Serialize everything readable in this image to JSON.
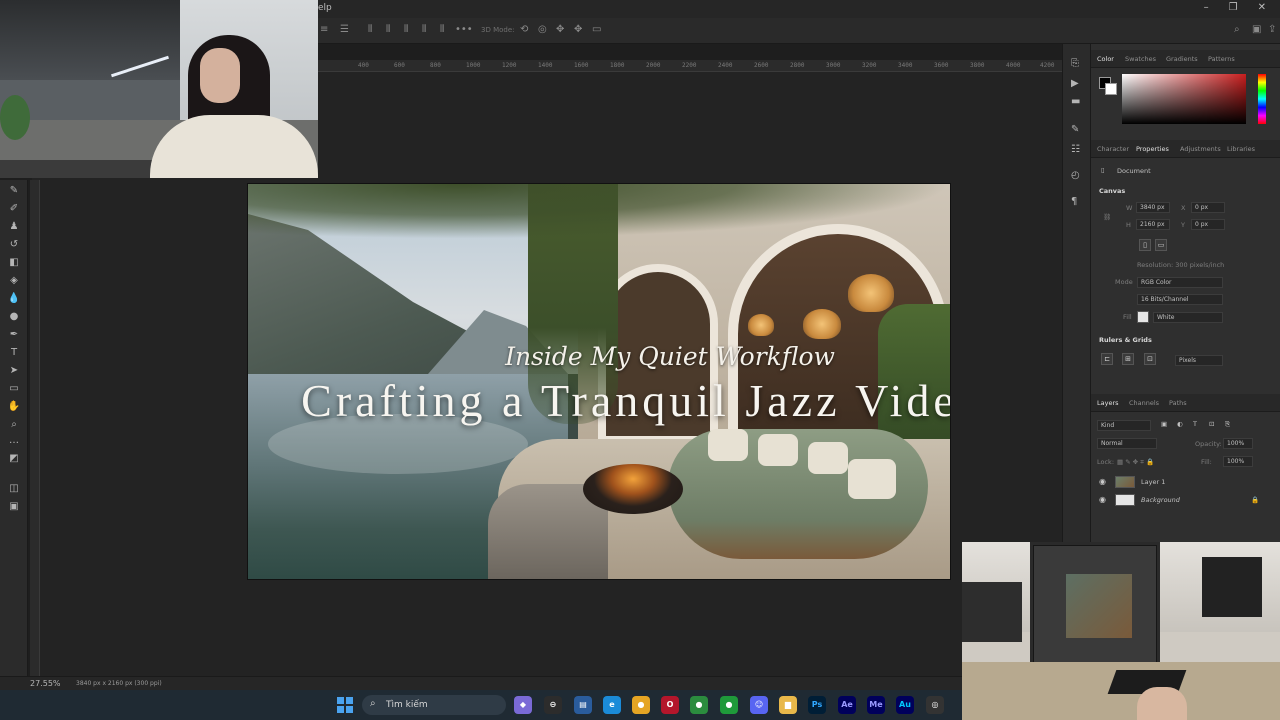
{
  "menubar": {
    "partial_label": "elp"
  },
  "options_bar": {
    "mode_label": "3D Mode:"
  },
  "ruler": {
    "ticks": [
      "400",
      "600",
      "800",
      "1000",
      "1200",
      "1400",
      "1600",
      "1800",
      "2000",
      "2200",
      "2400",
      "2600",
      "2800",
      "3000",
      "3200",
      "3400",
      "3600",
      "3800",
      "4000",
      "4200"
    ]
  },
  "canvas": {
    "subtitle": "Inside My Quiet Workflow",
    "title": "Crafting a Tranquil Jazz Video"
  },
  "statusbar": {
    "zoom": "27.55%",
    "doc_info": "3840 px x 2160 px (300 ppi)"
  },
  "color_panel": {
    "tabs": [
      "Color",
      "Swatches",
      "Gradients",
      "Patterns"
    ],
    "active": "Color"
  },
  "properties_panel": {
    "tabs": [
      "Character",
      "Properties",
      "Adjustments",
      "Libraries"
    ],
    "active": "Properties",
    "document_label": "Document",
    "canvas_header": "Canvas",
    "width_label": "W",
    "width_value": "3840 px",
    "height_label": "H",
    "height_value": "2160 px",
    "x_label": "X",
    "x_placeholder": "0 px",
    "y_label": "Y",
    "y_placeholder": "0 px",
    "resolution": "Resolution: 300 pixels/inch",
    "mode_label": "Mode",
    "mode_value": "RGB Color",
    "bits_value": "16 Bits/Channel",
    "fill_label": "Fill",
    "fill_value": "White",
    "rulers_header": "Rulers & Grids",
    "units_value": "Pixels"
  },
  "layers_panel": {
    "tabs": [
      "Layers",
      "Channels",
      "Paths"
    ],
    "active": "Layers",
    "filter_value": "Kind",
    "blend_mode": "Normal",
    "opacity_label": "Opacity:",
    "opacity_value": "100%",
    "lock_label": "Lock:",
    "fill_label": "Fill:",
    "fill_value": "100%",
    "layers": [
      {
        "name": "Layer 1"
      },
      {
        "name": "Background"
      }
    ]
  },
  "taskbar": {
    "search_placeholder": "Tìm kiếm",
    "apps": [
      "Ps",
      "Ae",
      "Me",
      "Au"
    ],
    "colors": {
      "ps": "#31a8ff",
      "ae": "#9999ff",
      "me": "#9999ff",
      "au": "#00c8ff"
    }
  }
}
